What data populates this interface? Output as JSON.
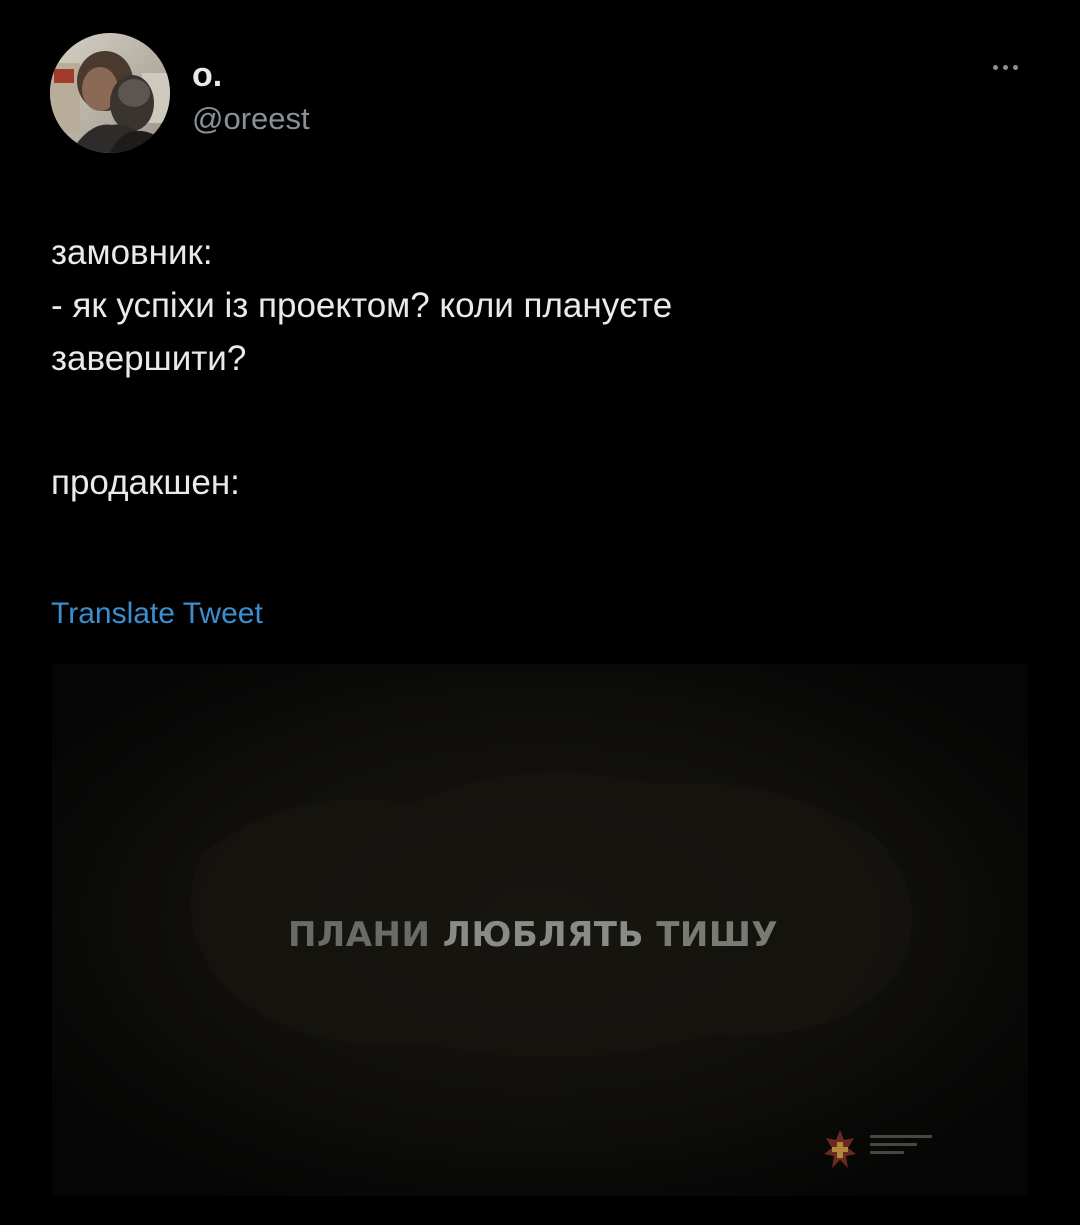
{
  "author": {
    "display_name": "о.",
    "handle": "@oreest",
    "avatar_icon": "profile-photo"
  },
  "menu": {
    "more_icon": "more-horizontal-icon"
  },
  "tweet": {
    "lines": [
      "замовник:",
      "- як успіхи із проектом? коли плануєте",
      "завершити?",
      "продакшен:"
    ],
    "translate_label": "Translate Tweet"
  },
  "media": {
    "caption_words": [
      "ПЛАНИ",
      "ЛЮБЛЯТЬ",
      "ТИШУ"
    ],
    "logo_icon": "ministry-of-defence-emblem"
  },
  "colors": {
    "background": "#000000",
    "text": "#e7e9ea",
    "secondary": "#8b9096",
    "link": "#3b8fd0"
  }
}
